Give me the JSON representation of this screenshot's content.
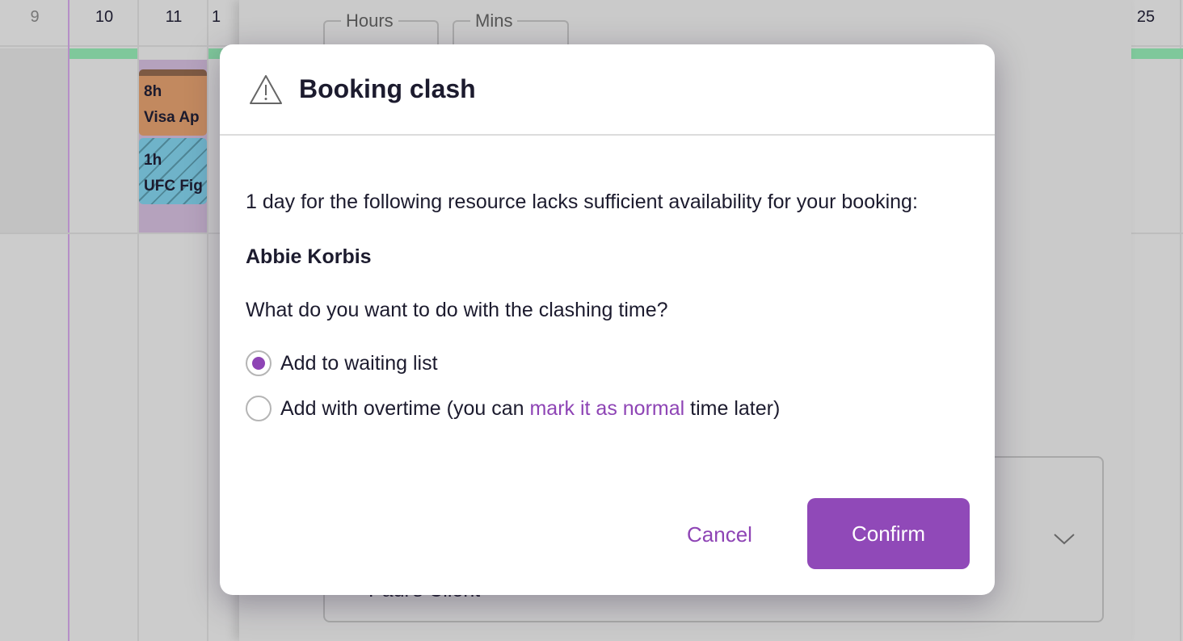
{
  "calendar": {
    "days": [
      "9",
      "10",
      "11",
      "1",
      "25"
    ],
    "events": [
      {
        "duration": "8h",
        "title": "Visa Ap",
        "color": "#c2895f"
      },
      {
        "duration": "1h",
        "title": "UFC Fig",
        "color": "#6fb3c9"
      }
    ]
  },
  "panel": {
    "hours_label": "Hours",
    "mins_label": "Mins",
    "client_value": "Paul's Client"
  },
  "dialog": {
    "icon": "warning-triangle-icon",
    "title": "Booking clash",
    "message": "1 day for the following resource lacks sufficient availability for your booking:",
    "resource": "Abbie Korbis",
    "question": "What do you want to do with the clashing time?",
    "options": [
      {
        "label": "Add to waiting list",
        "selected": true
      },
      {
        "label_before": "Add with overtime (you can ",
        "link": "mark it as normal",
        "label_after": " time later)",
        "selected": false
      }
    ],
    "cancel": "Cancel",
    "confirm": "Confirm",
    "accent": "#8e44b5"
  }
}
